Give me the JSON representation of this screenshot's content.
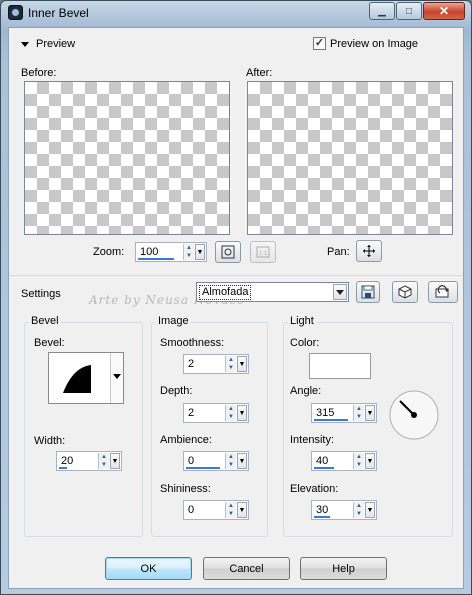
{
  "window": {
    "title": "Inner Bevel"
  },
  "caption_buttons": {
    "minimize": "▁",
    "maximize": "□",
    "close": "✕"
  },
  "preview_section": {
    "header": "Preview",
    "preview_on_image_label": "Preview on Image",
    "preview_on_image_checked": true,
    "before_label": "Before:",
    "after_label": "After:",
    "zoom_label": "Zoom:",
    "zoom_value": "100",
    "pan_label": "Pan:"
  },
  "settings": {
    "label": "Settings",
    "preset_value": "Almofada",
    "watermark": "Arte by Neusa Novaes"
  },
  "bevel_group": {
    "title": "Bevel",
    "bevel_label": "Bevel:",
    "width_label": "Width:",
    "width_value": "20",
    "width_fill": 0.2
  },
  "image_group": {
    "title": "Image",
    "smoothness_label": "Smoothness:",
    "smoothness_value": "2",
    "depth_label": "Depth:",
    "depth_value": "2",
    "ambience_label": "Ambience:",
    "ambience_value": "0",
    "shininess_label": "Shininess:",
    "shininess_value": "0"
  },
  "light_group": {
    "title": "Light",
    "color_label": "Color:",
    "color_value": "#ffffff",
    "angle_label": "Angle:",
    "angle_value": "315",
    "intensity_label": "Intensity:",
    "intensity_value": "40",
    "elevation_label": "Elevation:",
    "elevation_value": "30"
  },
  "buttons": {
    "ok": "OK",
    "cancel": "Cancel",
    "help": "Help"
  }
}
